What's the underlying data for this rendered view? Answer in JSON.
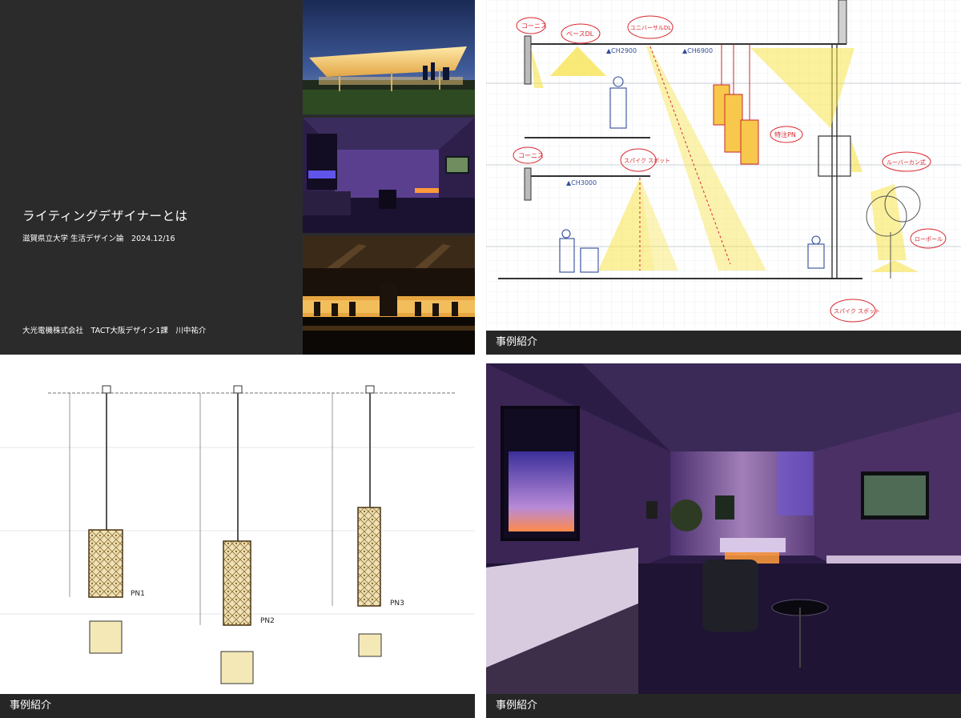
{
  "title_slide": {
    "title": "ライティングデザイナーとは",
    "subtitle": "滋賀県立大学 生活デザイン論　2024.12/16",
    "author": "大光電機株式会社　TACT大阪デザイン1課　川中祐介"
  },
  "sketch_slide": {
    "caption": "事例紹介",
    "annotations": {
      "cornice_top": "コーニス",
      "base_dl": "ベースDL",
      "universal_dl": "ユニバーサルDL",
      "ch2900": "▲CH2900",
      "ch6900": "▲CH6900",
      "special_pn": "特注PN",
      "cornice_bottom": "コーニス",
      "spike_spot": "スパイク スポット",
      "ch3000": "▲CH3000",
      "louver": "ルーバーカン式",
      "low_pole": "ローポール",
      "spike_spot_bottom": "スパイク スポット"
    }
  },
  "drawing_slide": {
    "caption": "事例紹介",
    "labels": {
      "pn1": "PN1",
      "pn2": "PN2",
      "pn3": "PN3"
    }
  },
  "room_slide": {
    "caption": "事例紹介"
  },
  "colors": {
    "dark_panel": "#2b2b2b",
    "caption_bar": "#262626",
    "sketch_yellow": "#f7e34b",
    "sketch_red": "#d9272e",
    "room_purple": "#6d3fb0"
  }
}
